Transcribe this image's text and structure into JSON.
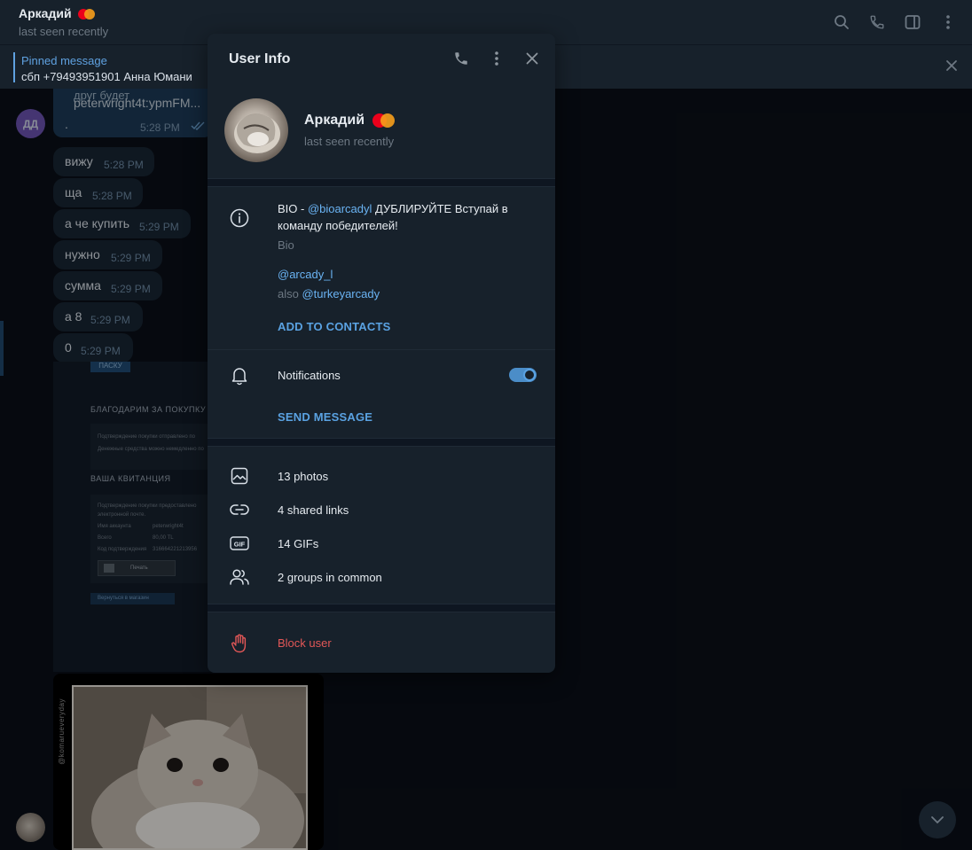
{
  "chat_header": {
    "name": "Аркадий",
    "status": "last seen recently",
    "icons": [
      "search-icon",
      "phone-icon",
      "sidebar-icon",
      "more-icon"
    ]
  },
  "pinned": {
    "title": "Pinned message",
    "text": "сбп +79493951901 Анна Юмани"
  },
  "chat": {
    "avatar_initials": "ДД",
    "cut_text": "друг будет",
    "outgoing": {
      "text": "peterwright4t:ypmFM...",
      "dot": ".",
      "time": "5:28 PM"
    },
    "messages": [
      {
        "text": "вижу",
        "time": "5:28 PM"
      },
      {
        "text": "ща",
        "time": "5:28 PM"
      },
      {
        "text": "а че купить",
        "time": "5:29 PM"
      },
      {
        "text": "нужно",
        "time": "5:29 PM"
      },
      {
        "text": "сумма",
        "time": "5:29 PM"
      },
      {
        "text": "а 8",
        "time": "5:29 PM"
      },
      {
        "text": "0",
        "time": "5:29 PM"
      }
    ],
    "receipt": {
      "tag": "ПАСКУ",
      "heading_thanks": "БЛАГОДАРИМ ЗА ПОКУПКУ",
      "line1": "Подтверждение покупки отправлено по",
      "line2": "Денежные средства можно немедленно по",
      "heading_receipt": "ВАША КВИТАНЦИЯ",
      "r_line1": "Подтверждение покупки предоставлено",
      "r_line2": "электронной почте.",
      "account_label": "Имя аккаунта",
      "account_value": "peterwright4t",
      "total_label": "Всего",
      "total_value": "80,00 TL",
      "code_label": "Код подтверждения",
      "code_value": "316664221213956",
      "print_label": "Печать",
      "back_label": "Вернуться в магазин"
    },
    "photo_caption": "@komarueveryday"
  },
  "user_info": {
    "title": "User Info",
    "name": "Аркадий",
    "status": "last seen recently",
    "bio": {
      "prefix": "BIO - ",
      "mention": "@bioarcadyl",
      "rest": " ДУБЛИРУЙТЕ Вступай в команду победителей!",
      "label": "Bio"
    },
    "username": "@arcady_l",
    "also_prefix": "also ",
    "also_username": "@turkeyarcady",
    "add_to_contacts": "ADD TO CONTACTS",
    "notifications_label": "Notifications",
    "notifications_enabled": true,
    "send_message": "SEND MESSAGE",
    "media": {
      "photos": "13 photos",
      "links": "4 shared links",
      "gifs": "14 GIFs",
      "groups": "2 groups in common"
    },
    "gif_badge": "GIF",
    "block_user": "Block user"
  },
  "colors": {
    "accent": "#5aa2e2",
    "link": "#6ab3f3",
    "danger": "#e25757",
    "panel_bg": "#17212b",
    "chat_bg": "#0e1621"
  }
}
